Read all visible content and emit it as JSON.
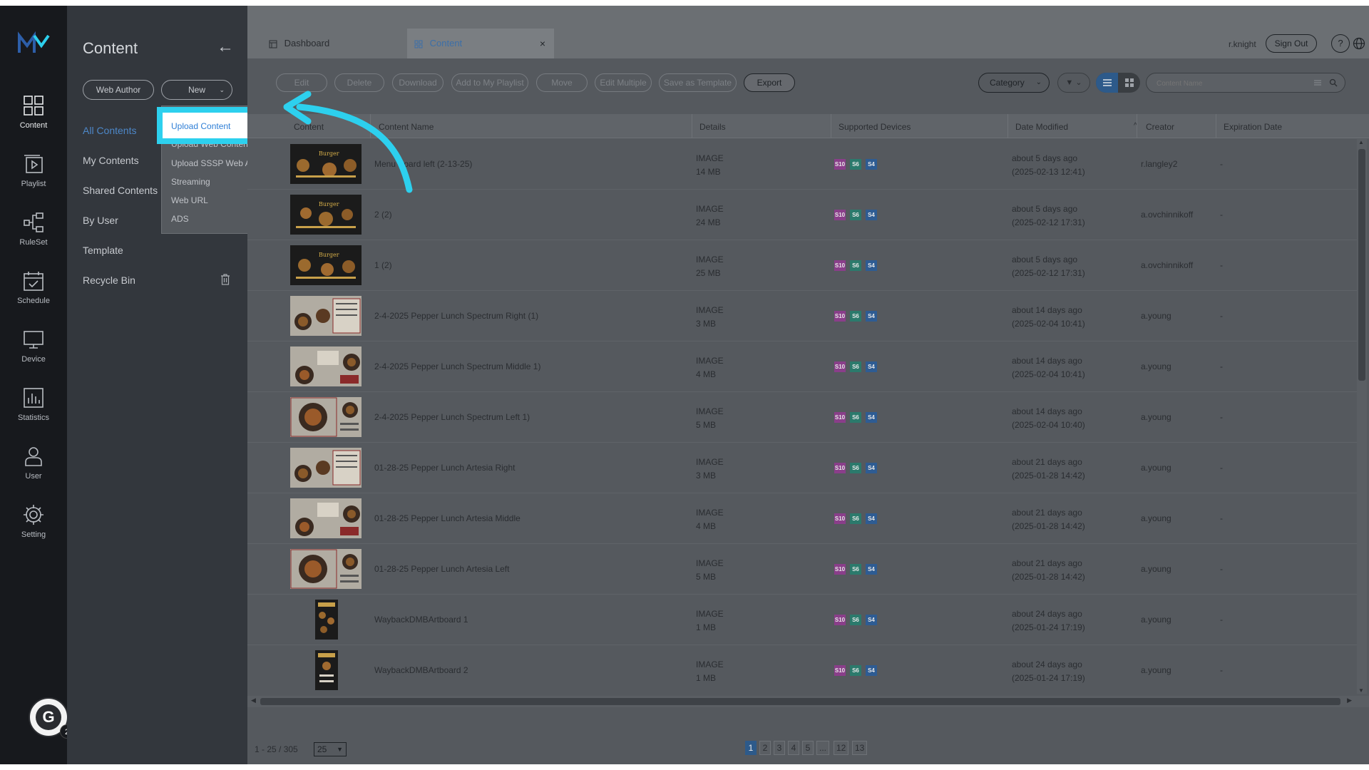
{
  "rail": {
    "items": [
      {
        "label": "Content",
        "icon": "grid-icon"
      },
      {
        "label": "Playlist",
        "icon": "playlist-icon"
      },
      {
        "label": "RuleSet",
        "icon": "ruleset-icon"
      },
      {
        "label": "Schedule",
        "icon": "calendar-icon"
      },
      {
        "label": "Device",
        "icon": "monitor-icon"
      },
      {
        "label": "Statistics",
        "icon": "chart-icon"
      },
      {
        "label": "User",
        "icon": "user-icon"
      },
      {
        "label": "Setting",
        "icon": "gear-icon"
      }
    ],
    "grammarly_letter": "G",
    "grammarly_badge": "2"
  },
  "panel": {
    "title": "Content",
    "web_author_label": "Web Author",
    "new_label": "New",
    "nav": [
      "All Contents",
      "My Contents",
      "Shared Contents",
      "By User",
      "Template",
      "Recycle Bin"
    ],
    "active_nav": "All Contents"
  },
  "dropdown": {
    "items": [
      "Upload Web Content",
      "Upload SSSP Web App",
      "Streaming",
      "Web URL",
      "ADS"
    ],
    "highlighted": "Upload Content"
  },
  "tabs": [
    {
      "label": "Dashboard"
    },
    {
      "label": "Content",
      "close": "×"
    }
  ],
  "header": {
    "username": "r.knight",
    "signout_label": "Sign Out",
    "help_label": "?"
  },
  "toolbar": {
    "buttons": [
      "Edit",
      "Delete",
      "Download",
      "Add to My Playlist",
      "Move",
      "Edit Multiple",
      "Save as Template",
      "Export"
    ],
    "category_label": "Category",
    "search_placeholder": "Content Name"
  },
  "table": {
    "columns": [
      "Content",
      "Content Name",
      "Details",
      "Supported Devices",
      "Date Modified",
      "Creator",
      "Expiration Date"
    ],
    "device_badges": [
      "S10",
      "S6",
      "S4"
    ],
    "rows": [
      {
        "name": "Menu Board left (2-13-25)",
        "type": "IMAGE",
        "size": "14 MB",
        "ago": "about 5 days ago",
        "date": "(2025-02-13 12:41)",
        "creator": "r.langley2",
        "exp": "-"
      },
      {
        "name": "2 (2)",
        "type": "IMAGE",
        "size": "24 MB",
        "ago": "about 5 days ago",
        "date": "(2025-02-12 17:31)",
        "creator": "a.ovchinnikoff",
        "exp": "-"
      },
      {
        "name": "1 (2)",
        "type": "IMAGE",
        "size": "25 MB",
        "ago": "about 5 days ago",
        "date": "(2025-02-12 17:31)",
        "creator": "a.ovchinnikoff",
        "exp": "-"
      },
      {
        "name": "2-4-2025 Pepper Lunch Spectrum Right (1)",
        "type": "IMAGE",
        "size": "3 MB",
        "ago": "about 14 days ago",
        "date": "(2025-02-04 10:41)",
        "creator": "a.young",
        "exp": "-"
      },
      {
        "name": "2-4-2025 Pepper Lunch Spectrum Middle 1)",
        "type": "IMAGE",
        "size": "4 MB",
        "ago": "about 14 days ago",
        "date": "(2025-02-04 10:41)",
        "creator": "a.young",
        "exp": "-"
      },
      {
        "name": "2-4-2025 Pepper Lunch Spectrum Left 1)",
        "type": "IMAGE",
        "size": "5 MB",
        "ago": "about 14 days ago",
        "date": "(2025-02-04 10:40)",
        "creator": "a.young",
        "exp": "-"
      },
      {
        "name": "01-28-25 Pepper Lunch Artesia Right",
        "type": "IMAGE",
        "size": "3 MB",
        "ago": "about 21 days ago",
        "date": "(2025-01-28 14:42)",
        "creator": "a.young",
        "exp": "-"
      },
      {
        "name": "01-28-25 Pepper Lunch Artesia Middle",
        "type": "IMAGE",
        "size": "4 MB",
        "ago": "about 21 days ago",
        "date": "(2025-01-28 14:42)",
        "creator": "a.young",
        "exp": "-"
      },
      {
        "name": "01-28-25 Pepper Lunch Artesia Left",
        "type": "IMAGE",
        "size": "5 MB",
        "ago": "about 21 days ago",
        "date": "(2025-01-28 14:42)",
        "creator": "a.young",
        "exp": "-"
      },
      {
        "name": "WaybackDMBArtboard 1",
        "type": "IMAGE",
        "size": "1 MB",
        "ago": "about 24 days ago",
        "date": "(2025-01-24 17:19)",
        "creator": "a.young",
        "exp": "-"
      },
      {
        "name": "WaybackDMBArtboard 2",
        "type": "IMAGE",
        "size": "1 MB",
        "ago": "about 24 days ago",
        "date": "(2025-01-24 17:19)",
        "creator": "a.young",
        "exp": "-"
      }
    ]
  },
  "footer": {
    "count": "1 - 25 / 305",
    "page_size": "25",
    "pages": [
      "1",
      "2",
      "3",
      "4",
      "5",
      "...",
      "12",
      "13"
    ],
    "active_page": "1"
  },
  "colors": {
    "highlight": "#2dd0ee",
    "accent": "#4d87c8",
    "rail": "#17191d"
  }
}
